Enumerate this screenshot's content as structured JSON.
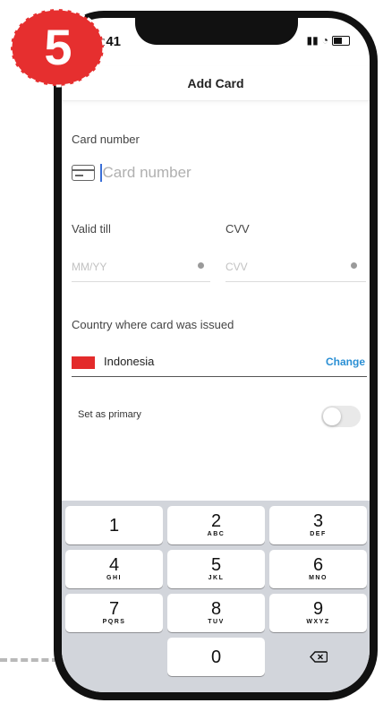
{
  "step_badge": "5",
  "status": {
    "time": "9:41"
  },
  "header": {
    "title": "Add Card"
  },
  "card": {
    "label": "Card number",
    "placeholder": "Card number"
  },
  "valid_till": {
    "label": "Valid till",
    "placeholder": "MM/YY"
  },
  "cvv": {
    "label": "CVV",
    "placeholder": "CVV"
  },
  "country": {
    "label": "Country where card was issued",
    "name": "Indonesia",
    "change_label": "Change"
  },
  "primary": {
    "label": "Set as primary",
    "enabled": false
  },
  "keypad": {
    "keys": [
      {
        "digit": "1",
        "letters": ""
      },
      {
        "digit": "2",
        "letters": "ABC"
      },
      {
        "digit": "3",
        "letters": "DEF"
      },
      {
        "digit": "4",
        "letters": "GHI"
      },
      {
        "digit": "5",
        "letters": "JKL"
      },
      {
        "digit": "6",
        "letters": "MNO"
      },
      {
        "digit": "7",
        "letters": "PQRS"
      },
      {
        "digit": "8",
        "letters": "TUV"
      },
      {
        "digit": "9",
        "letters": "WXYZ"
      },
      {
        "digit": "0",
        "letters": ""
      }
    ]
  },
  "colors": {
    "badge": "#e62f2f",
    "accent": "#2a8fd4",
    "flag": "#e32b2b"
  }
}
